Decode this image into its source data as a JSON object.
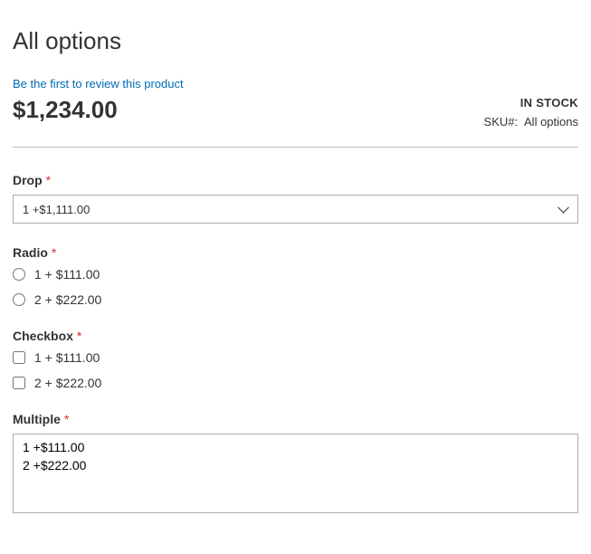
{
  "header": {
    "title": "All options"
  },
  "review": {
    "link_text": "Be the first to review this product"
  },
  "price": "$1,234.00",
  "stock": {
    "status": "IN STOCK",
    "sku_label": "SKU#:",
    "sku_value": "All options"
  },
  "options": {
    "drop": {
      "label": "Drop",
      "selected": "1 +$1,111.00"
    },
    "radio": {
      "label": "Radio",
      "items": [
        {
          "label": "1 + $111.00"
        },
        {
          "label": "2 + $222.00"
        }
      ]
    },
    "checkbox": {
      "label": "Checkbox",
      "items": [
        {
          "label": "1 + $111.00"
        },
        {
          "label": "2 + $222.00"
        }
      ]
    },
    "multiple": {
      "label": "Multiple",
      "items": [
        {
          "label": "1 +$111.00"
        },
        {
          "label": "2 +$222.00"
        }
      ]
    }
  },
  "required_mark": "*"
}
